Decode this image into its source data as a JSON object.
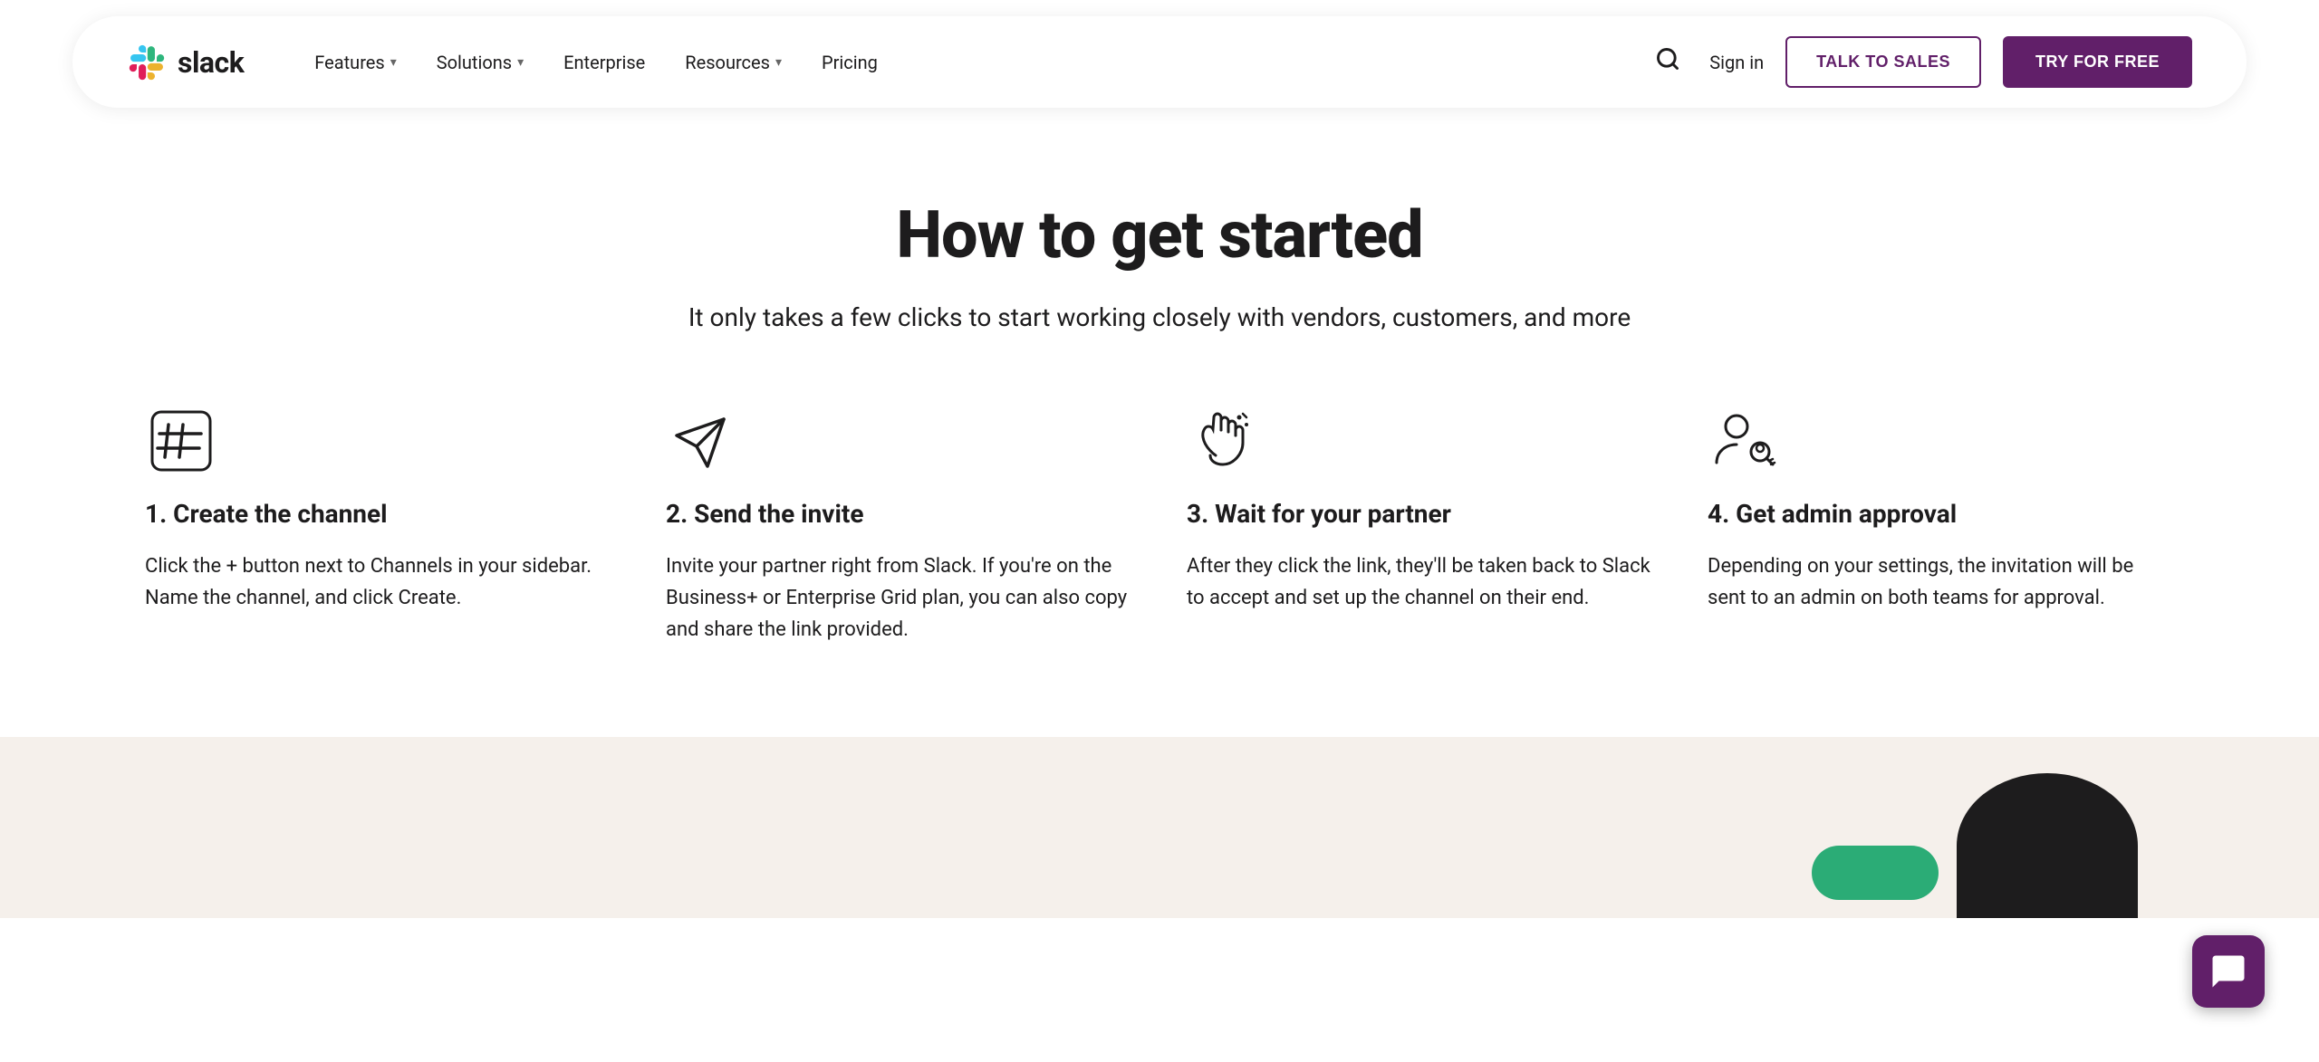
{
  "nav": {
    "logo_text": "slack",
    "links": [
      {
        "label": "Features",
        "has_dropdown": true
      },
      {
        "label": "Solutions",
        "has_dropdown": true
      },
      {
        "label": "Enterprise",
        "has_dropdown": false
      },
      {
        "label": "Resources",
        "has_dropdown": true
      },
      {
        "label": "Pricing",
        "has_dropdown": false
      }
    ],
    "signin_label": "Sign in",
    "talk_to_sales_label": "TALK TO SALES",
    "try_for_free_label": "TRY FOR FREE"
  },
  "main": {
    "title": "How to get started",
    "subtitle": "It only takes a few clicks to start working closely with vendors, customers, and more",
    "steps": [
      {
        "number": "1",
        "title": "1. Create the channel",
        "description": "Click the + button next to Channels in your sidebar. Name the channel, and click Create.",
        "icon": "hash-icon"
      },
      {
        "number": "2",
        "title": "2. Send the invite",
        "description": "Invite your partner right from Slack. If you're on the Business+ or Enterprise Grid plan, you can also copy and share the link provided.",
        "icon": "send-icon"
      },
      {
        "number": "3",
        "title": "3. Wait for your partner",
        "description": "After they click the link, they'll be taken back to Slack to accept and set up the channel on their end.",
        "icon": "wave-icon"
      },
      {
        "number": "4",
        "title": "4. Get admin approval",
        "description": "Depending on your settings, the invitation will be sent to an admin on both teams for approval.",
        "icon": "admin-icon"
      }
    ]
  }
}
